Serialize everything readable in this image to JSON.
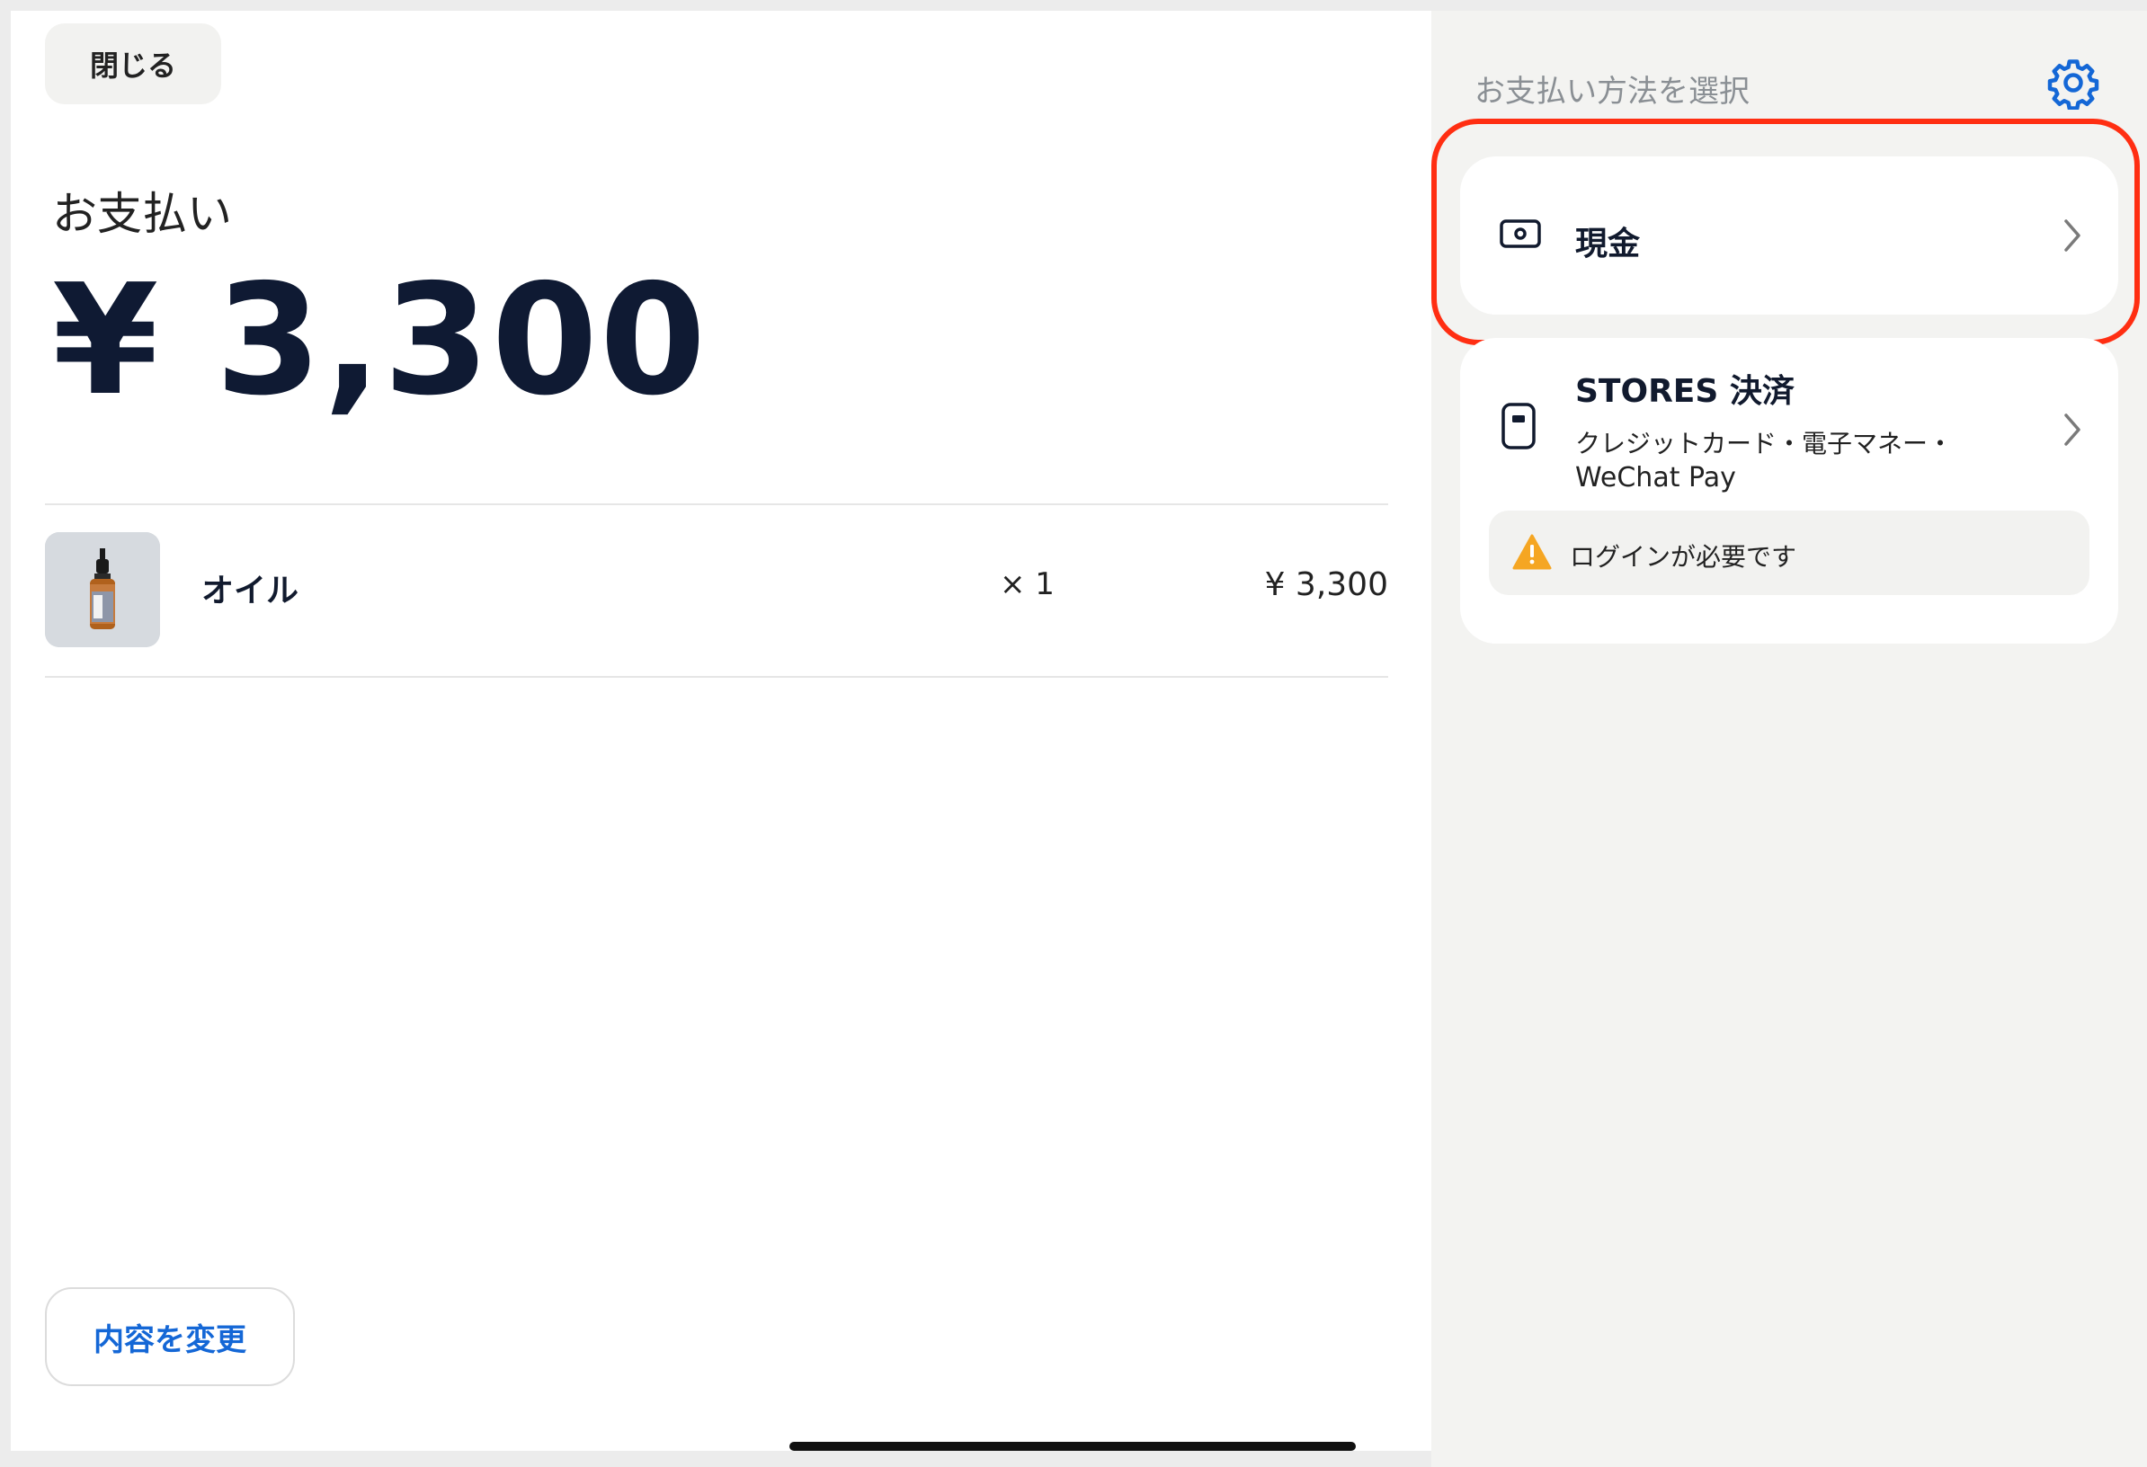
{
  "header": {
    "close_label": "閉じる"
  },
  "payment": {
    "label": "お支払い",
    "amount": "¥ 3,300"
  },
  "items": [
    {
      "name": "オイル",
      "qty": "× 1",
      "price": "¥ 3,300"
    }
  ],
  "edit_label": "内容を変更",
  "methods_panel": {
    "title": "お支払い方法を選択",
    "cash": {
      "label": "現金"
    },
    "stores": {
      "title": "STORES 決済",
      "desc_line1": "クレジットカード・電子マネー・",
      "desc_line2": "WeChat Pay",
      "notice": "ログインが必要です"
    }
  },
  "colors": {
    "accent": "#1467d6",
    "highlight": "#ff2e12",
    "warning": "#f5a623",
    "amount_text": "#0f1a33"
  },
  "icons": [
    "gear-icon",
    "cash-icon",
    "card-reader-icon",
    "chevron-right-icon",
    "warning-icon"
  ]
}
